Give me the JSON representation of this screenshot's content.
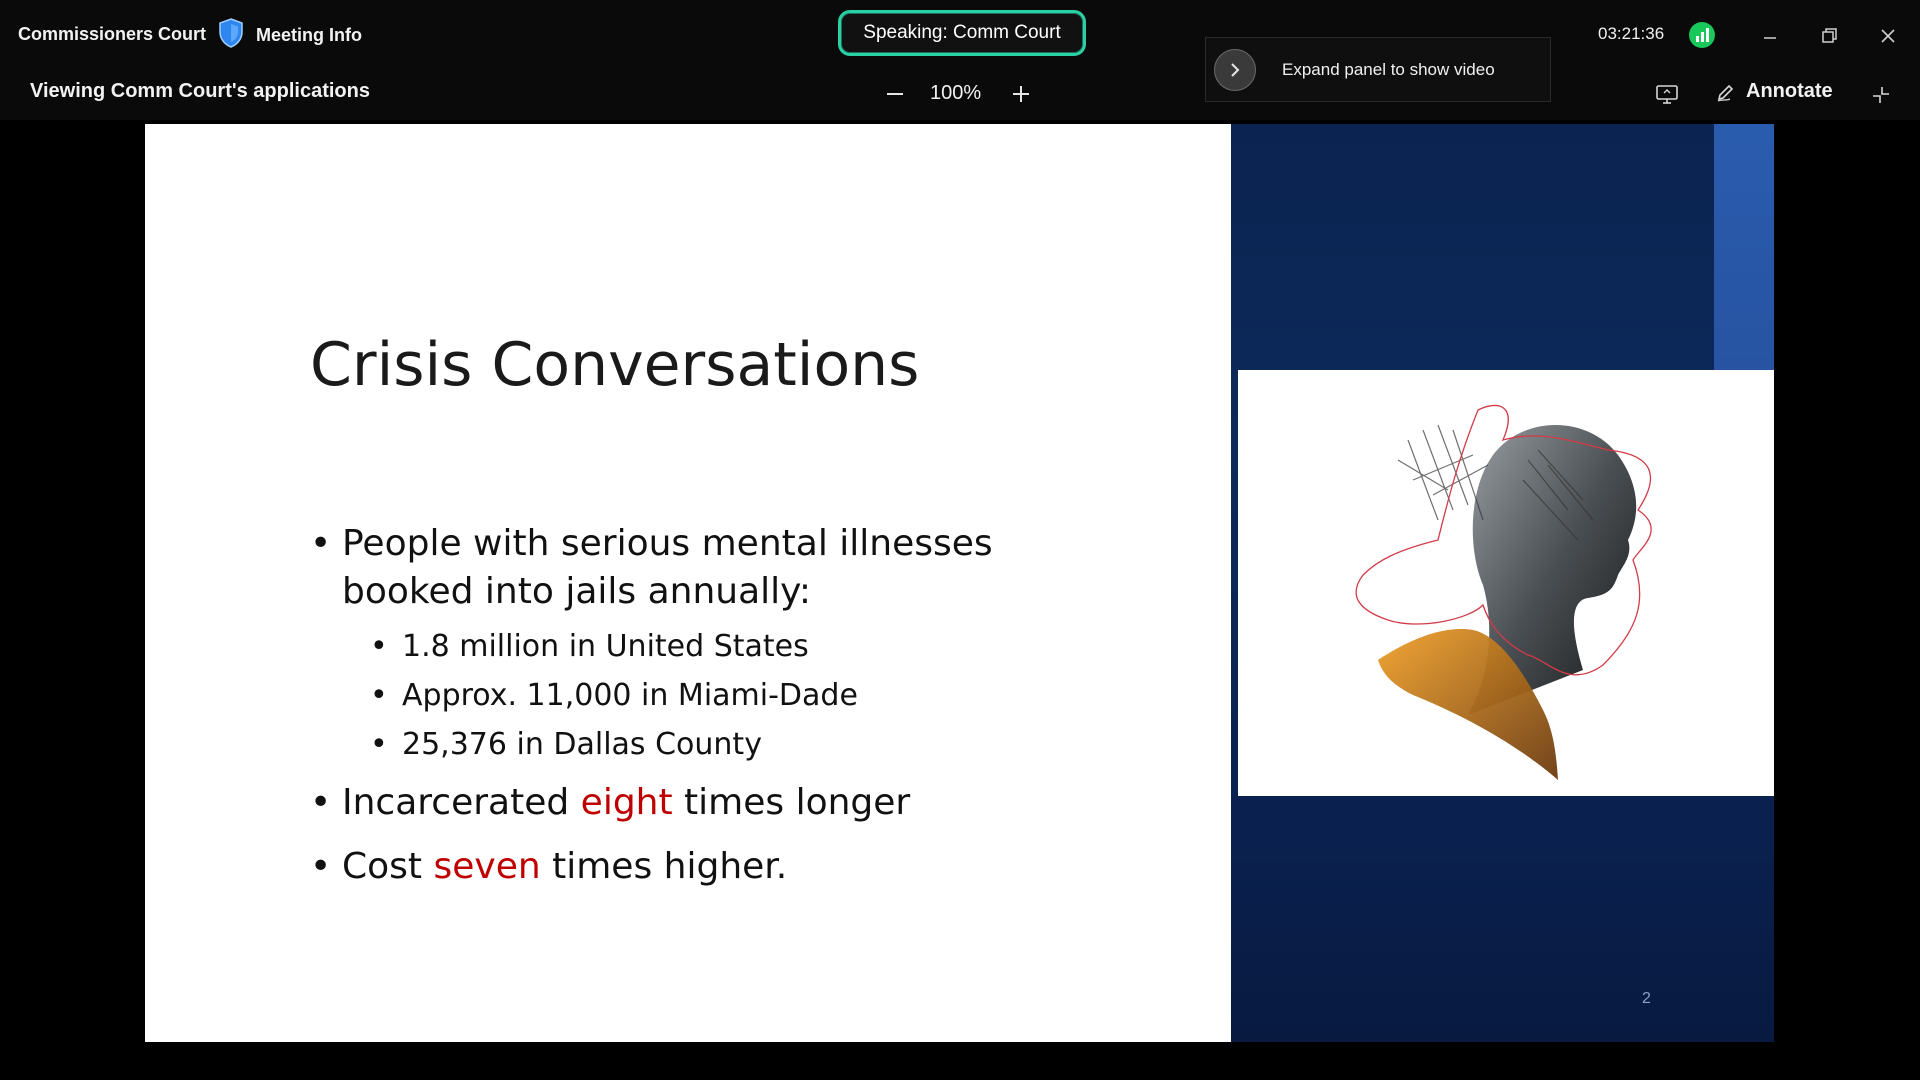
{
  "app": {
    "meeting_name": "Commissioners Court",
    "meeting_info_label": "Meeting Info",
    "speaking_label": "Speaking: Comm Court",
    "viewing_label": "Viewing Comm Court's applications",
    "zoom_level": "100%",
    "expand_panel_text": "Expand panel to show video",
    "clock": "03:21:36",
    "annotate_label": "Annotate",
    "colors": {
      "speaking_border": "#2ad1a5",
      "signal": "#19c85a",
      "shield": "#2f86f0"
    }
  },
  "slide": {
    "title": "Crisis Conversations",
    "bullets": [
      {
        "lines": [
          "People with serious mental illnesses",
          "booked into jails annually:"
        ]
      },
      {
        "pre": "Incarcerated ",
        "accent": "eight",
        "post": " times longer"
      },
      {
        "pre": "Cost ",
        "accent": "seven",
        "post": " times higher."
      }
    ],
    "sub_bullets": [
      "1.8 million in United States",
      "Approx. 11,000 in Miami-Dade",
      "25,376 in Dallas County"
    ],
    "page_number": "2",
    "accent_color": "#c00000"
  }
}
